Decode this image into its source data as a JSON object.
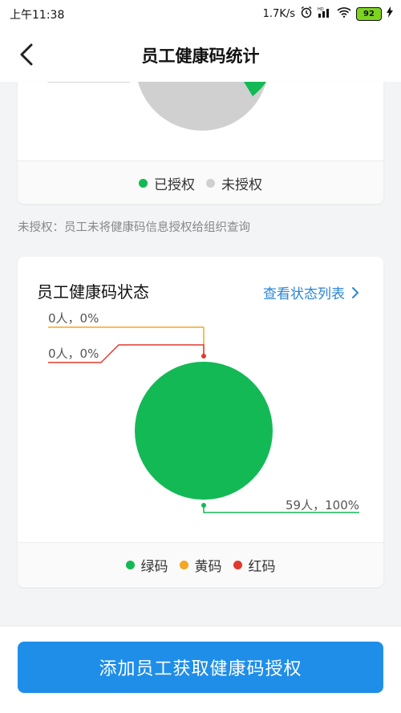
{
  "status": {
    "time": "上午11:38",
    "speed": "1.7K/s",
    "battery": "92"
  },
  "nav": {
    "title": "员工健康码统计"
  },
  "auth_card": {
    "legend": [
      {
        "label": "已授权",
        "color": "#13b955"
      },
      {
        "label": "未授权",
        "color": "#d0d0d0"
      }
    ]
  },
  "note": "未授权：员工未将健康码信息授权给组织查询",
  "status_card": {
    "title": "员工健康码状态",
    "link": "查看状态列表",
    "labels": {
      "yellow": "0人，0%",
      "red": "0人，0%",
      "green": "59人，100%"
    },
    "legend": [
      {
        "label": "绿码",
        "color": "#13b955"
      },
      {
        "label": "黄码",
        "color": "#f5a623"
      },
      {
        "label": "红码",
        "color": "#e03a2f"
      }
    ]
  },
  "button": {
    "label": "添加员工获取健康码授权"
  }
}
